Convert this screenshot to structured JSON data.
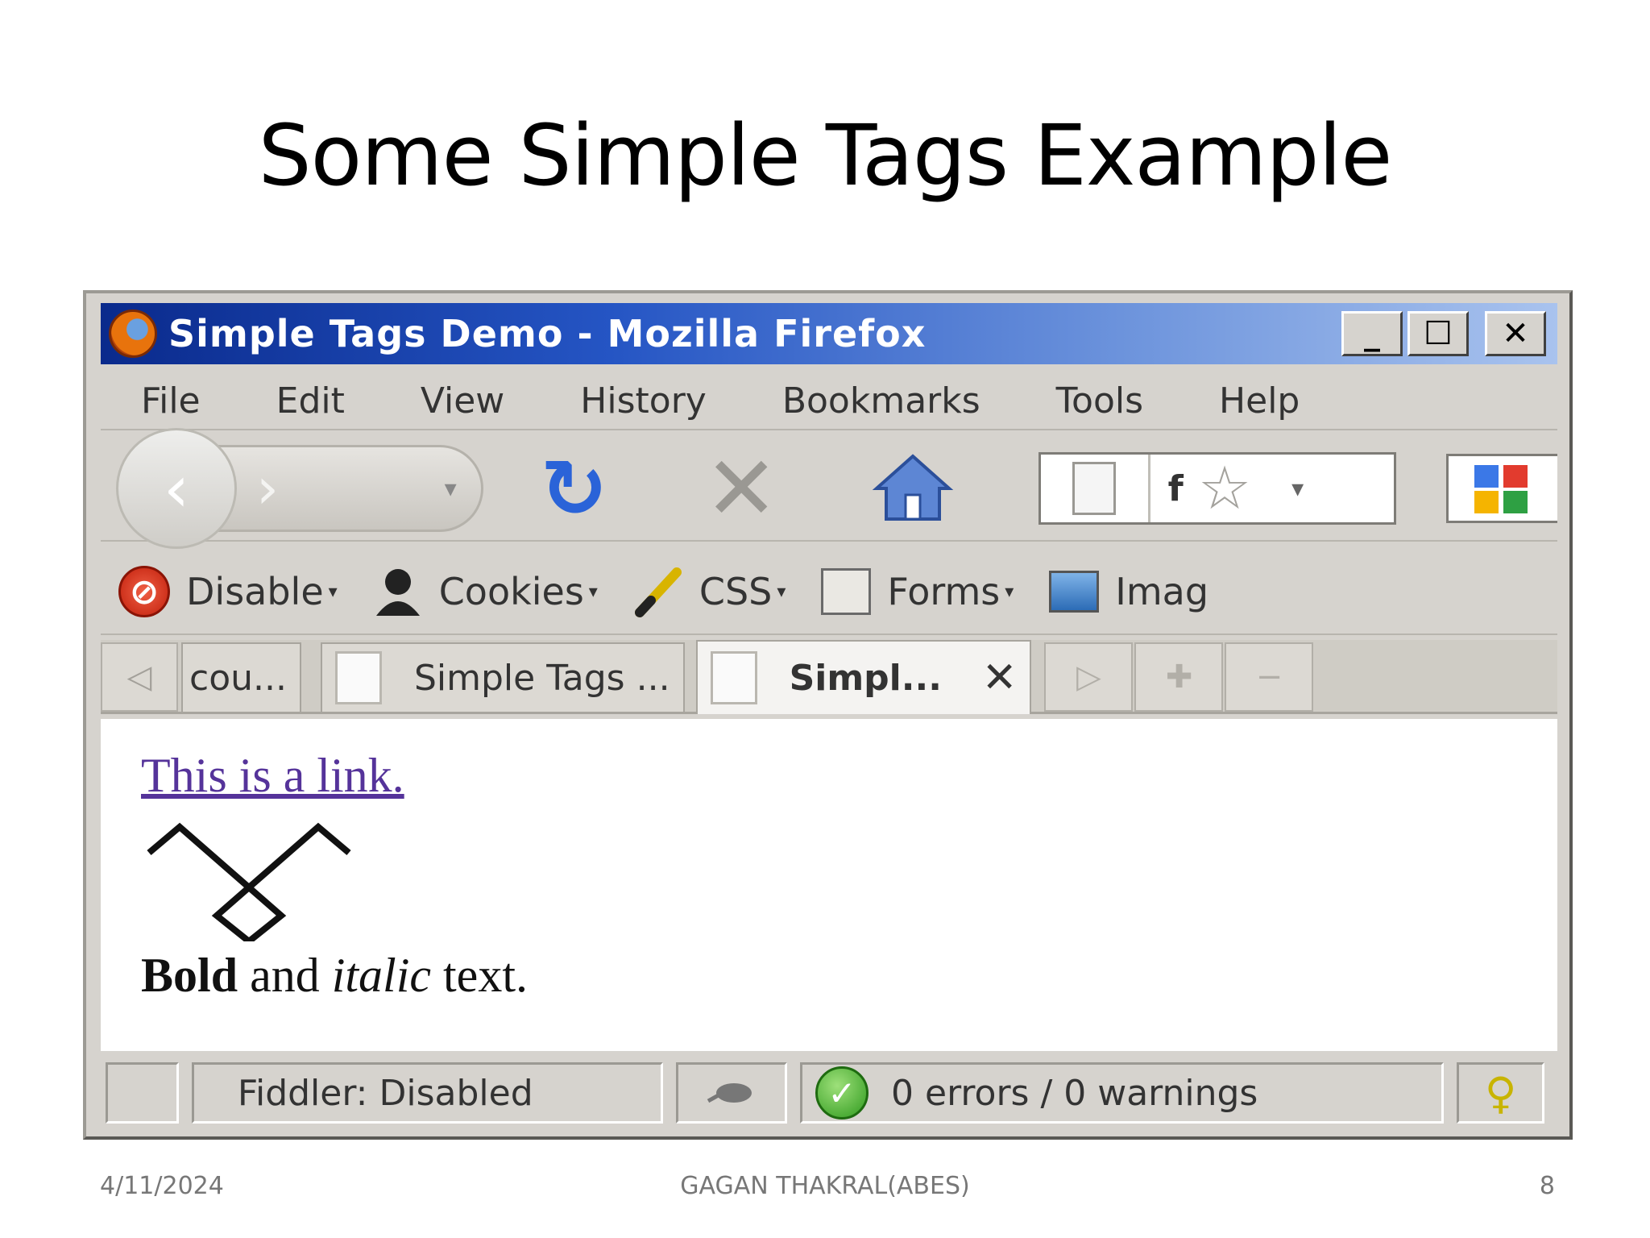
{
  "slide": {
    "title": "Some Simple Tags Example",
    "footer": {
      "date": "4/11/2024",
      "author": "GAGAN THAKRAL(ABES)",
      "page_number": "8"
    }
  },
  "browser": {
    "window_title": "Simple Tags Demo - Mozilla Firefox",
    "window_buttons": {
      "minimize": "_",
      "maximize": "☐",
      "close": "✕"
    },
    "menu": [
      "File",
      "Edit",
      "View",
      "History",
      "Bookmarks",
      "Tools",
      "Help"
    ],
    "nav_icons": {
      "back": "back-arrow-icon",
      "forward": "forward-arrow-icon",
      "reload": "reload-icon",
      "stop": "stop-icon",
      "home": "home-icon",
      "bookmark_star": "star-icon"
    },
    "urlbar": {
      "text": "f"
    },
    "dev_toolbar": [
      {
        "label": "Disable",
        "icon": "disable-icon"
      },
      {
        "label": "Cookies",
        "icon": "cookies-icon"
      },
      {
        "label": "CSS",
        "icon": "css-icon"
      },
      {
        "label": "Forms",
        "icon": "forms-icon"
      },
      {
        "label": "Imag",
        "icon": "images-icon"
      }
    ],
    "tabs": [
      {
        "label": "cou...",
        "active": false
      },
      {
        "label": "Simple Tags ...",
        "active": false
      },
      {
        "label": "Simpl...",
        "active": true
      }
    ],
    "tab_close_glyph": "✕",
    "page_content": {
      "link_text": "This is a link.",
      "bold_word": "Bold",
      "middle_text": " and ",
      "italic_word": "italic",
      "end_text": " text."
    },
    "statusbar": {
      "fiddler": "Fiddler: Disabled",
      "validation": "0 errors / 0 warnings"
    },
    "colors": {
      "titlebar_start": "#0a2a8c",
      "titlebar_end": "#a9c3ee",
      "chrome_bg": "#d6d3ce",
      "link": "#55339a",
      "reload_blue": "#2a63d8",
      "status_ok_green": "#2f9a1e"
    }
  }
}
